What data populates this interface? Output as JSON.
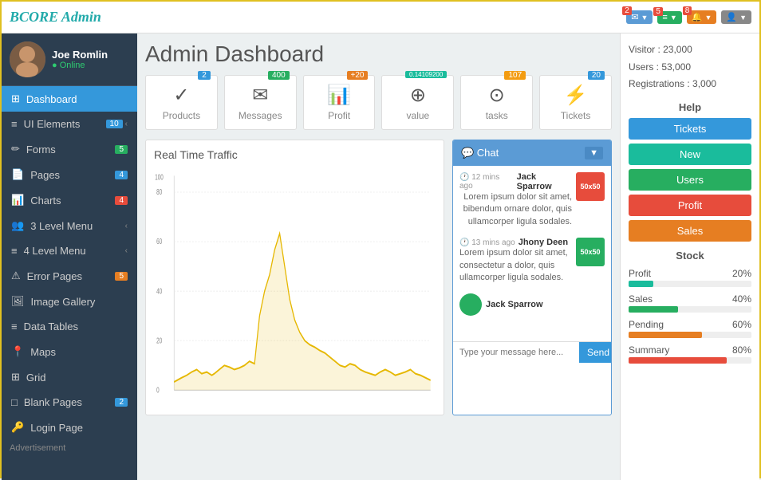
{
  "header": {
    "logo": "BCORE Admin",
    "badges": [
      {
        "count": "2",
        "icon": "✉",
        "arrow": "▼"
      },
      {
        "count": "5",
        "icon": "≡",
        "arrow": "▼"
      },
      {
        "count": "8",
        "icon": "🔔",
        "arrow": "▼"
      },
      {
        "icon": "👤",
        "arrow": "▼"
      }
    ]
  },
  "sidebar": {
    "user": {
      "name": "Joe Romlin",
      "status": "● Online"
    },
    "items": [
      {
        "label": "Dashboard",
        "icon": "⊞",
        "active": true,
        "badge": null
      },
      {
        "label": "UI Elements",
        "icon": "≡",
        "active": false,
        "badge": "10",
        "badgeColor": "blue",
        "hasChevron": true
      },
      {
        "label": "Forms",
        "icon": "✏",
        "active": false,
        "badge": "5",
        "badgeColor": "green"
      },
      {
        "label": "Pages",
        "icon": "📄",
        "active": false,
        "badge": "4",
        "badgeColor": "blue"
      },
      {
        "label": "Charts",
        "icon": "📊",
        "active": false,
        "badge": "4",
        "badgeColor": "red"
      },
      {
        "label": "3 Level Menu",
        "icon": "👥",
        "active": false,
        "badge": null,
        "hasChevron": true
      },
      {
        "label": "4 Level Menu",
        "icon": "≡",
        "active": false,
        "badge": null,
        "hasChevron": true
      },
      {
        "label": "Error Pages",
        "icon": "⚠",
        "active": false,
        "badge": "5",
        "badgeColor": "orange"
      },
      {
        "label": "Image Gallery",
        "icon": "🖼",
        "active": false,
        "badge": null
      },
      {
        "label": "Data Tables",
        "icon": "≡",
        "active": false,
        "badge": null
      },
      {
        "label": "Maps",
        "icon": "📍",
        "active": false,
        "badge": null
      },
      {
        "label": "Grid",
        "icon": "⊞",
        "active": false,
        "badge": null
      },
      {
        "label": "Blank Pages",
        "icon": "□",
        "active": false,
        "badge": "2",
        "badgeColor": "blue"
      },
      {
        "label": "Login Page",
        "icon": "🔑",
        "active": false,
        "badge": null
      }
    ],
    "advertisement": "Advertisement"
  },
  "main": {
    "title": "Admin Dashboard",
    "stats": [
      {
        "label": "Products",
        "icon": "✓",
        "badge": "2",
        "badgeColor": "blue"
      },
      {
        "label": "Messages",
        "icon": "✉",
        "badge": "400",
        "badgeColor": "green"
      },
      {
        "label": "Profit",
        "icon": "📊",
        "badge": "+20",
        "badgeColor": "orange"
      },
      {
        "label": "value",
        "icon": "⊕",
        "badge": "0.14109200",
        "badgeColor": "teal"
      },
      {
        "label": "tasks",
        "icon": "⊙",
        "badge": "107",
        "badgeColor": "yellow"
      },
      {
        "label": "Tickets",
        "icon": "⚡",
        "badge": "20",
        "badgeColor": "blue"
      }
    ],
    "chart": {
      "title": "Real Time Traffic",
      "yMax": 100,
      "yMin": 0
    },
    "chat": {
      "title": "💬 Chat",
      "messages": [
        {
          "name": "Jack Sparrow",
          "time": "12 mins ago",
          "text": "Lorem ipsum dolor sit amet, bibendum ornare dolor, quis ullamcorper ligula sodales.",
          "avatar": "50x50",
          "avatarColor": "red",
          "align": "right"
        },
        {
          "name": "Jhony Deen",
          "time": "13 mins ago",
          "text": "Lorem ipsum dolor sit amet, consectetur a dolor, quis ullamcorper ligula sodales.",
          "avatar": "50x50",
          "avatarColor": "green",
          "align": "left"
        },
        {
          "name": "Jack Sparrow",
          "time": "",
          "text": "",
          "avatar": "",
          "avatarColor": "green",
          "align": "left"
        }
      ],
      "inputPlaceholder": "Type your message here...",
      "sendLabel": "Send"
    }
  },
  "rightPanel": {
    "visitorStats": {
      "visitor": "Visitor  :  23,000",
      "users": "Users   :  53,000",
      "registrations": "Registrations  :  3,000"
    },
    "help": {
      "title": "Help",
      "buttons": [
        {
          "label": "Tickets",
          "color": "blue"
        },
        {
          "label": "New",
          "color": "teal"
        },
        {
          "label": "Users",
          "color": "green"
        },
        {
          "label": "Profit",
          "color": "red"
        },
        {
          "label": "Sales",
          "color": "orange"
        }
      ]
    },
    "stock": {
      "title": "Stock",
      "items": [
        {
          "label": "Profit",
          "value": "20%",
          "percent": 20,
          "color": "teal"
        },
        {
          "label": "Sales",
          "value": "40%",
          "percent": 40,
          "color": "green"
        },
        {
          "label": "Pending",
          "value": "60%",
          "percent": 60,
          "color": "orange"
        },
        {
          "label": "Summary",
          "value": "80%",
          "percent": 80,
          "color": "red"
        }
      ]
    }
  }
}
